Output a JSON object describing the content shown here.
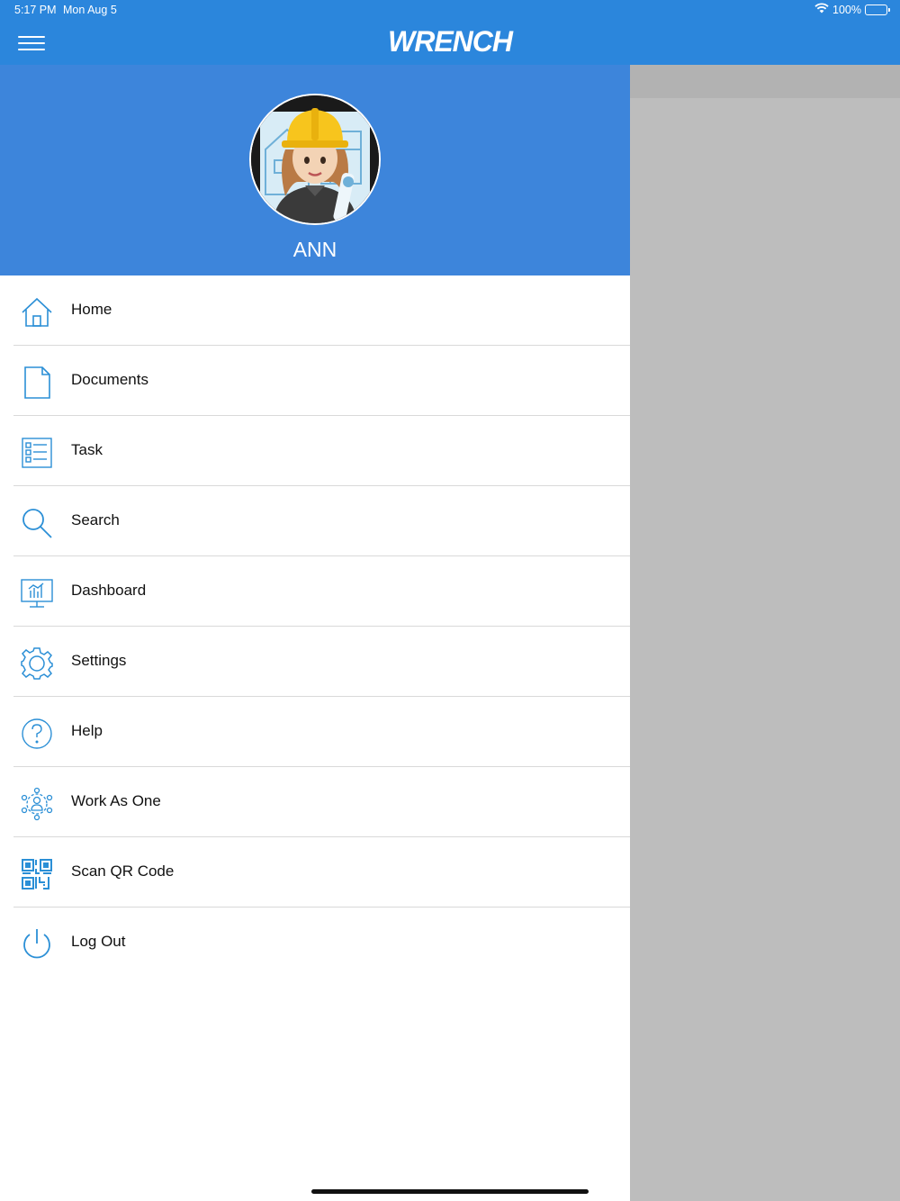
{
  "status_bar": {
    "time": "5:17 PM",
    "date": "Mon Aug 5",
    "battery": "100%"
  },
  "header": {
    "logo_text": "WRENCH"
  },
  "profile": {
    "name": "ANN"
  },
  "menu": {
    "items": [
      {
        "label": "Home",
        "icon": "home-icon"
      },
      {
        "label": "Documents",
        "icon": "document-icon"
      },
      {
        "label": "Task",
        "icon": "task-list-icon"
      },
      {
        "label": "Search",
        "icon": "search-icon"
      },
      {
        "label": "Dashboard",
        "icon": "dashboard-icon"
      },
      {
        "label": "Settings",
        "icon": "gear-icon"
      },
      {
        "label": "Help",
        "icon": "help-icon"
      },
      {
        "label": "Work As One",
        "icon": "team-network-icon"
      },
      {
        "label": "Scan QR Code",
        "icon": "qr-code-icon"
      },
      {
        "label": "Log Out",
        "icon": "power-icon"
      }
    ]
  },
  "colors": {
    "brand_blue": "#2b86dc",
    "profile_blue": "#3d85db",
    "icon_blue": "#2b8fd6"
  }
}
